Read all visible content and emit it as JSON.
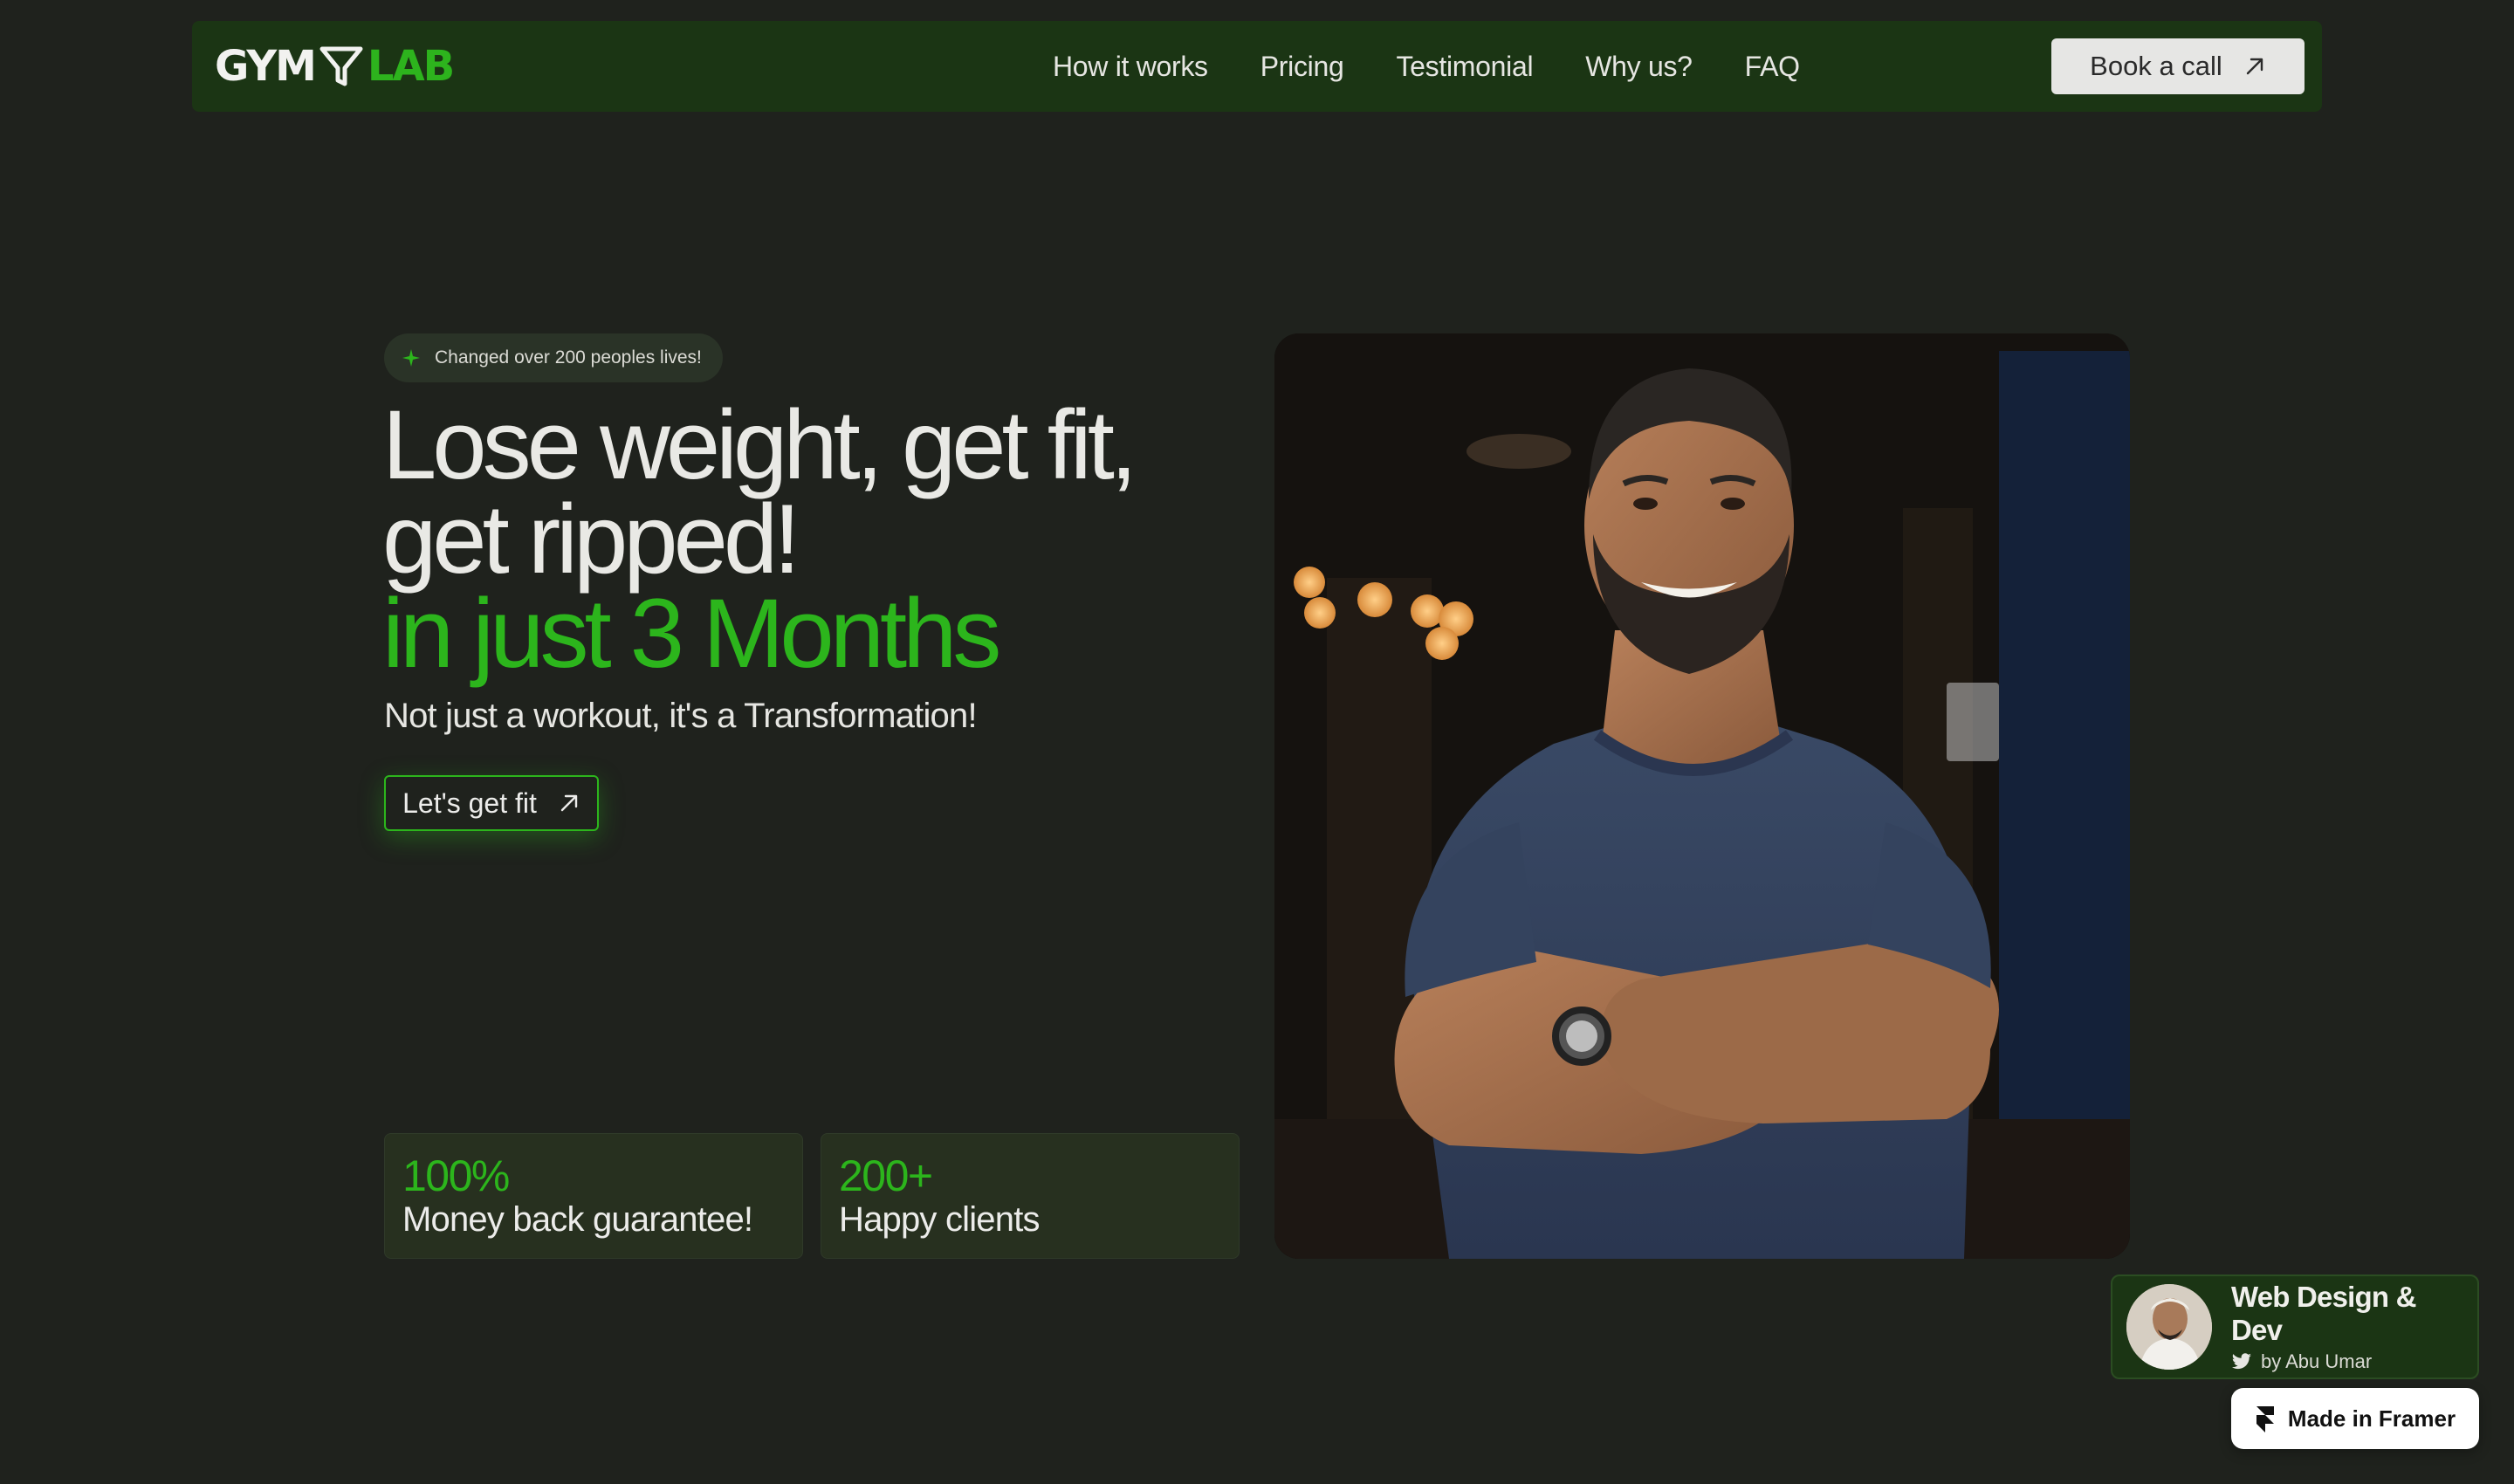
{
  "brand": {
    "logo_left": "GYM",
    "logo_right": "LAB",
    "accent_color": "#2cb51c",
    "nav_background": "#1b3514"
  },
  "nav": {
    "links": [
      "How it works",
      "Pricing",
      "Testimonial",
      "Why us?",
      "FAQ"
    ],
    "cta_label": "Book a call",
    "cta_icon": "arrow-up-right-icon"
  },
  "hero": {
    "badge_icon": "sparkle-icon",
    "badge_text": "Changed over 200 peoples lives!",
    "headline_line1": "Lose weight, get fit,",
    "headline_line2": "get ripped!",
    "headline_accent": "in just 3 Months",
    "subheadline": "Not just a workout, it's a Transformation!",
    "cta_label": "Let's get fit",
    "cta_icon": "arrow-up-right-icon",
    "image": "smiling-bearded-man-arms-crossed-gym-photo"
  },
  "stats": [
    {
      "value": "100%",
      "label": "Money back guarantee!"
    },
    {
      "value": "200+",
      "label": "Happy clients"
    }
  ],
  "creator": {
    "title": "Web Design & Dev",
    "by_icon": "twitter-icon",
    "by_text": "by Abu Umar"
  },
  "framer": {
    "icon": "framer-icon",
    "label": "Made in Framer"
  }
}
